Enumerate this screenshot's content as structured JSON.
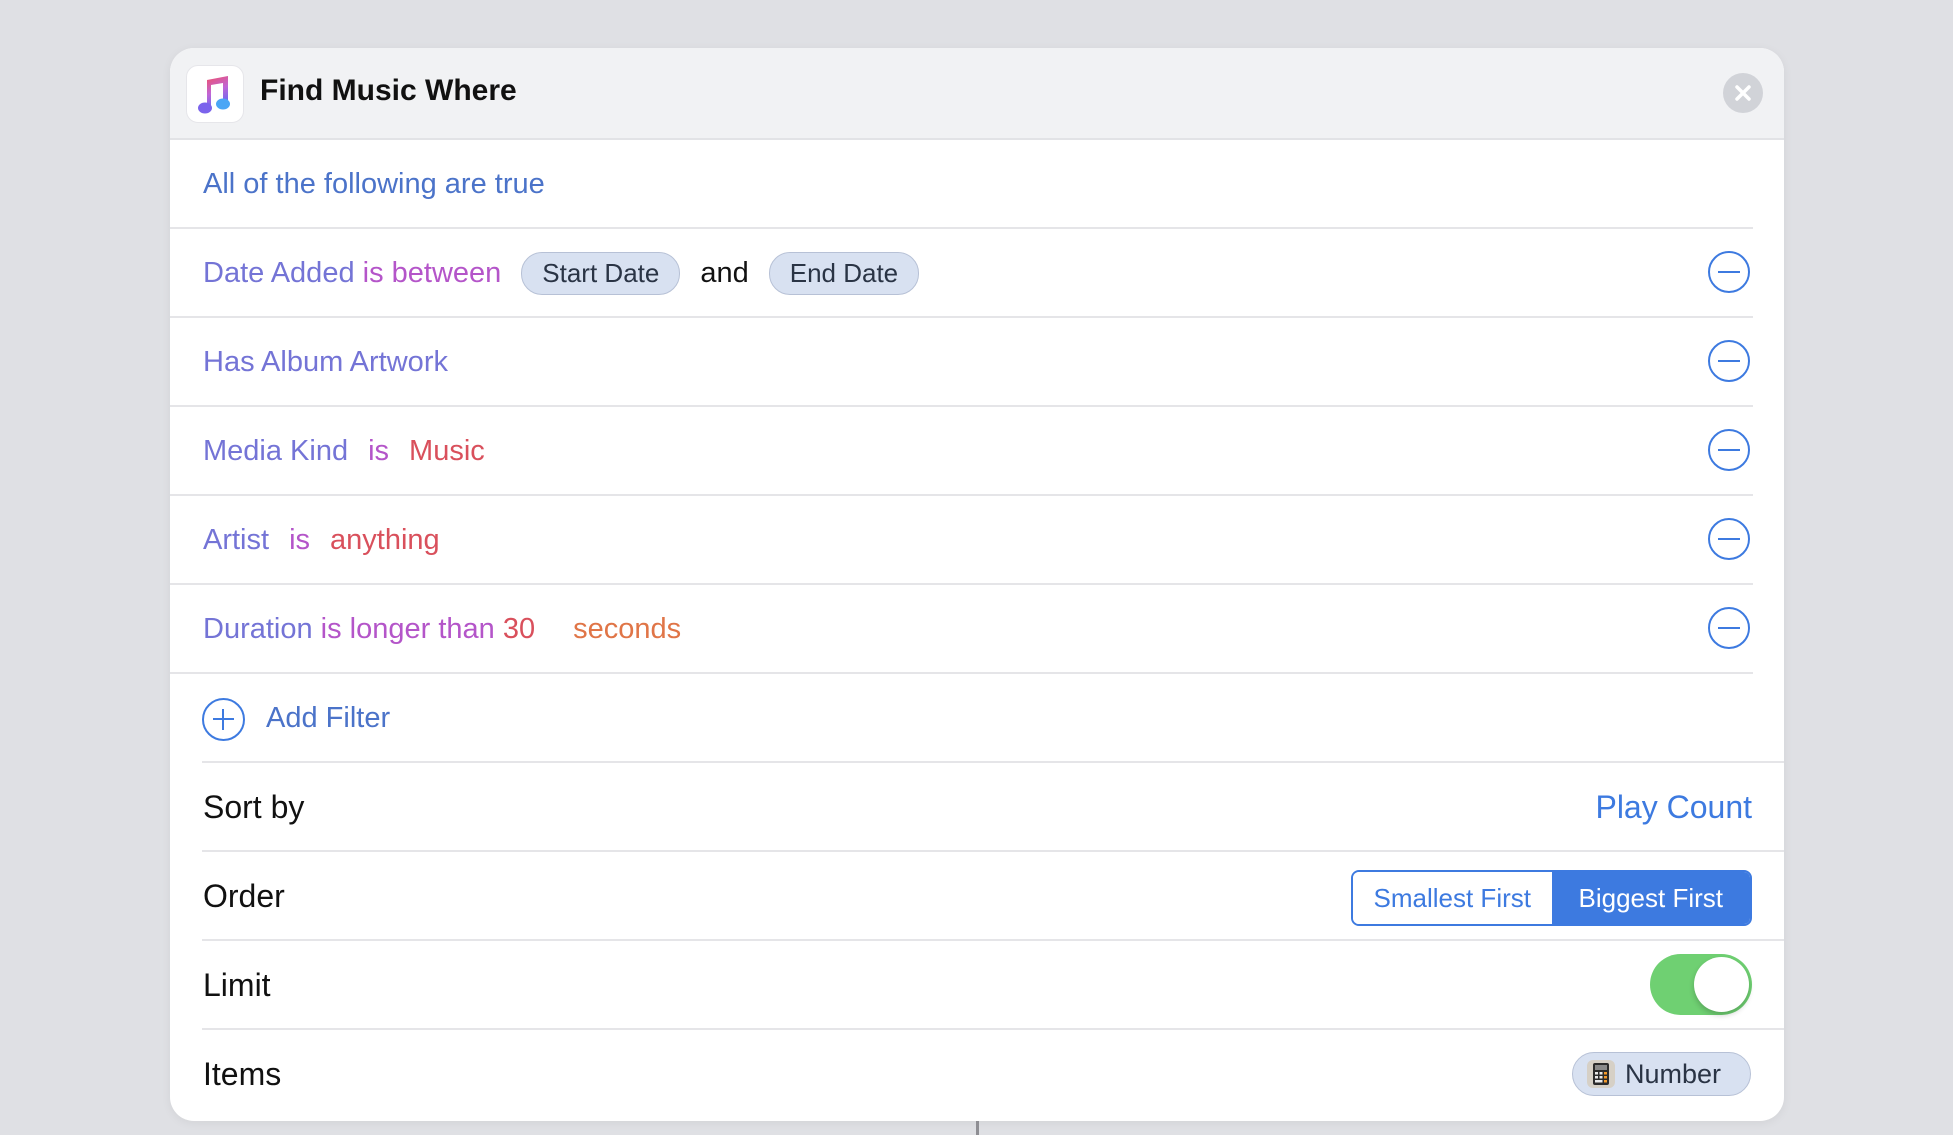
{
  "header": {
    "title": "Find Music Where",
    "app_icon": "music-note-icon",
    "close_icon": "close-icon"
  },
  "filters": {
    "match_mode": "All of the following are true",
    "rows": [
      {
        "parts": [
          {
            "text": "Date Added",
            "kind": "field"
          },
          {
            "text": " is between",
            "kind": "operator"
          }
        ],
        "start_pill": "Start Date",
        "joiner": "and",
        "end_pill": "End Date"
      },
      {
        "parts": [
          {
            "text": "Has Album Artwork",
            "kind": "field"
          }
        ]
      },
      {
        "parts": [
          {
            "text": "Media Kind",
            "kind": "field"
          },
          {
            "text": "is",
            "kind": "operator"
          },
          {
            "text": "Music",
            "kind": "value"
          }
        ]
      },
      {
        "parts": [
          {
            "text": "Artist",
            "kind": "field"
          },
          {
            "text": "is",
            "kind": "operator"
          },
          {
            "text": "anything",
            "kind": "value"
          }
        ]
      },
      {
        "parts": [
          {
            "text": "Duration",
            "kind": "field"
          },
          {
            "text": " is longer than",
            "kind": "operator"
          },
          {
            "text": " 30",
            "kind": "value"
          },
          {
            "text": "seconds",
            "kind": "unit"
          }
        ]
      }
    ],
    "remove_icon": "minus-circle-icon",
    "add_label": "Add Filter",
    "add_icon": "plus-circle-icon"
  },
  "sort": {
    "label": "Sort by",
    "value": "Play Count"
  },
  "order": {
    "label": "Order",
    "options": [
      "Smallest First",
      "Biggest First"
    ],
    "selected": "Biggest First"
  },
  "limit": {
    "label": "Limit",
    "enabled": true
  },
  "items": {
    "label": "Items",
    "value": "Number",
    "icon": "calculator-icon"
  },
  "colors": {
    "accent": "#3d7ae0",
    "toggle_on": "#6fd072",
    "field": "#7474d6",
    "operator": "#b455c9",
    "value": "#d9505c",
    "unit": "#e07547"
  }
}
